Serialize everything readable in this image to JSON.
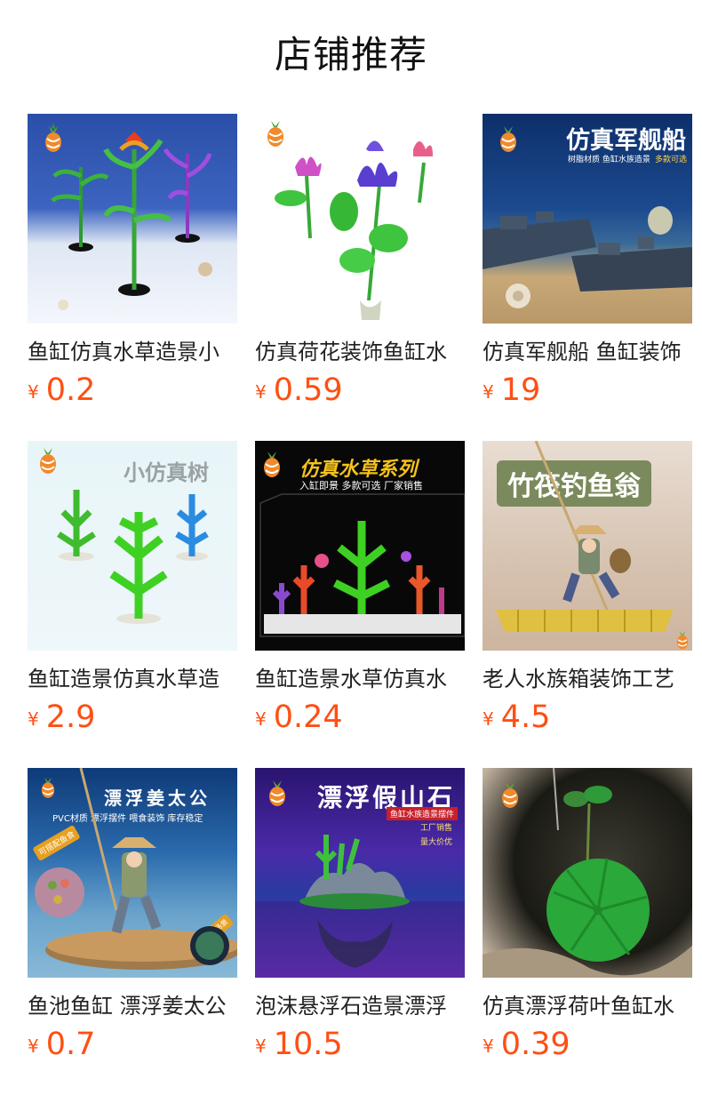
{
  "page": {
    "title": "店铺推荐"
  },
  "products": [
    {
      "name": "鱼缸仿真水草造景小",
      "price": "0.2",
      "image": {
        "icon": "plant-decor-icon"
      }
    },
    {
      "name": "仿真荷花装饰鱼缸水",
      "price": "0.59",
      "image": {
        "icon": "lotus-decor-icon"
      }
    },
    {
      "name": "仿真军舰船 鱼缸装饰",
      "price": "19",
      "image": {
        "icon": "battleship-decor-icon",
        "overlay_title": "仿真军舰船",
        "overlay_subtitle": "树脂材质 鱼缸水族造景",
        "overlay_badge": "多款可选"
      }
    },
    {
      "name": "鱼缸造景仿真水草造",
      "price": "2.9",
      "image": {
        "icon": "green-plant-icon",
        "overlay_title": "小仿真树"
      }
    },
    {
      "name": "鱼缸造景水草仿真水",
      "price": "0.24",
      "image": {
        "icon": "aquarium-plants-icon",
        "overlay_title": "仿真水草系列",
        "overlay_subtitle": "入缸即景 多款可选 厂家销售"
      }
    },
    {
      "name": "老人水族箱装饰工艺",
      "price": "4.5",
      "image": {
        "icon": "fisherman-figure-icon",
        "overlay_title": "竹筏钓鱼翁"
      }
    },
    {
      "name": "鱼池鱼缸 漂浮姜太公",
      "price": "0.7",
      "image": {
        "icon": "floating-fisherman-icon",
        "overlay_title": "漂浮姜太公",
        "overlay_subtitle": "PVC材质 漂浮摆件 喂食装饰 库存稳定",
        "overlay_badge": "可搭配鱼食",
        "overlay_badge2": "喂食使用场景"
      }
    },
    {
      "name": "泡沫悬浮石造景漂浮",
      "price": "10.5",
      "image": {
        "icon": "floating-rock-icon",
        "overlay_title": "漂浮假山石",
        "overlay_tags": [
          "鱼缸水族造景摆件",
          "工厂销售",
          "量大价优"
        ]
      }
    },
    {
      "name": "仿真漂浮荷叶鱼缸水",
      "price": "0.39",
      "image": {
        "icon": "lotus-leaf-icon"
      }
    }
  ],
  "currency_symbol": "¥",
  "colors": {
    "price": "#ff4f13",
    "text": "#222222"
  }
}
